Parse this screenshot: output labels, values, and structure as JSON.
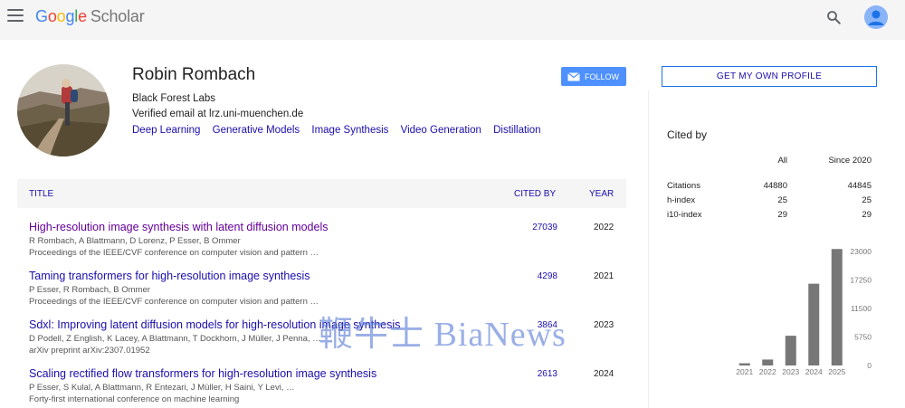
{
  "header": {
    "logo_letters": [
      "G",
      "o",
      "o",
      "g",
      "l",
      "e"
    ],
    "logo_product": "Scholar",
    "menu_icon": "hamburger-menu-icon",
    "search_icon": "search-icon",
    "avatar_icon": "account-avatar-icon"
  },
  "profile": {
    "name": "Robin Rombach",
    "affiliation": "Black Forest Labs",
    "email": "Verified email at lrz.uni-muenchen.de",
    "interests": [
      "Deep Learning",
      "Generative Models",
      "Image Synthesis",
      "Video Generation",
      "Distillation"
    ],
    "follow_label": "FOLLOW",
    "get_profile_label": "GET MY OWN PROFILE"
  },
  "publications": {
    "headers": {
      "title": "TITLE",
      "cited_by": "CITED BY",
      "year": "YEAR"
    },
    "rows": [
      {
        "title": "High-resolution image synthesis with latent diffusion models",
        "authors": "R Rombach, A Blattmann, D Lorenz, P Esser, B Ommer",
        "venue": "Proceedings of the IEEE/CVF conference on computer vision and pattern …",
        "cited": "27039",
        "year": "2022"
      },
      {
        "title": "Taming transformers for high-resolution image synthesis",
        "authors": "P Esser, R Rombach, B Ommer",
        "venue": "Proceedings of the IEEE/CVF conference on computer vision and pattern …",
        "cited": "4298",
        "year": "2021"
      },
      {
        "title": "Sdxl: Improving latent diffusion models for high-resolution image synthesis",
        "authors": "D Podell, Z English, K Lacey, A Blattmann, T Dockhorn, J Müller, J Penna, …",
        "venue": "arXiv preprint arXiv:2307.01952",
        "cited": "3864",
        "year": "2023"
      },
      {
        "title": "Scaling rectified flow transformers for high-resolution image synthesis",
        "authors": "P Esser, S Kulal, A Blattmann, R Entezari, J Müller, H Saini, Y Levi, …",
        "venue": "Forty-first international conference on machine learning",
        "cited": "2613",
        "year": "2024"
      }
    ]
  },
  "cited_by": {
    "title": "Cited by",
    "col_all": "All",
    "col_since": "Since 2020",
    "stats": [
      {
        "label": "Citations",
        "all": "44880",
        "since": "44845"
      },
      {
        "label": "h-index",
        "all": "25",
        "since": "25"
      },
      {
        "label": "i10-index",
        "all": "29",
        "since": "29"
      }
    ]
  },
  "chart_data": {
    "type": "bar",
    "categories": [
      "2021",
      "2022",
      "2023",
      "2024",
      "2025"
    ],
    "values": [
      450,
      1200,
      6000,
      16500,
      23500
    ],
    "ylim": [
      0,
      23000
    ],
    "yticks": [
      "23000",
      "17250",
      "11500",
      "5750",
      "0"
    ],
    "bar_color": "#777777",
    "grid": false
  },
  "watermark": "鞭牛士 BiaNews",
  "colors": {
    "link": "#1a0dab",
    "visited": "#660099",
    "follow_bg": "#4d90fe",
    "header_bg": "#f5f5f5"
  }
}
